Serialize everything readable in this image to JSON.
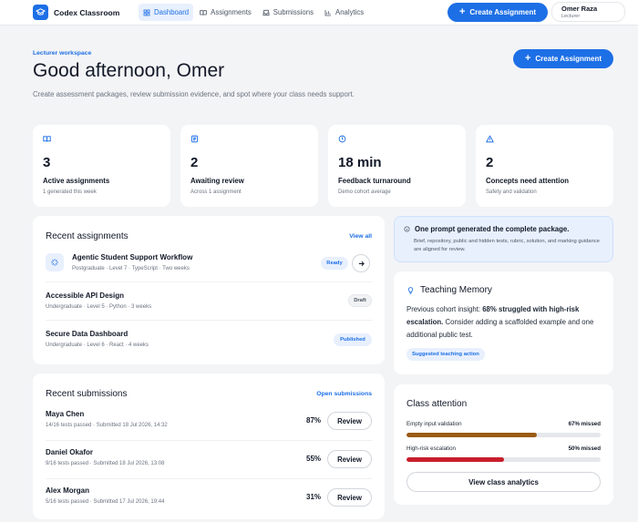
{
  "app": {
    "name": "Codex Classroom"
  },
  "nav": {
    "items": [
      {
        "label": "Dashboard",
        "icon": "grid-icon",
        "active": true
      },
      {
        "label": "Assignments",
        "icon": "book-icon",
        "active": false
      },
      {
        "label": "Submissions",
        "icon": "inbox-icon",
        "active": false
      },
      {
        "label": "Analytics",
        "icon": "bar-chart-icon",
        "active": false
      }
    ]
  },
  "top_create_label": "Create Assignment",
  "user": {
    "name": "Omer Raza",
    "role": "Lecturer"
  },
  "header": {
    "eyebrow": "Lecturer workspace",
    "greeting": "Good afternoon, Omer",
    "subtitle": "Create assessment packages, review submission evidence, and spot where your class needs support.",
    "create_label": "Create Assignment"
  },
  "stats": [
    {
      "icon": "book-open-icon",
      "value": "3",
      "label": "Active assignments",
      "sub": "1 generated this week"
    },
    {
      "icon": "document-icon",
      "value": "2",
      "label": "Awaiting review",
      "sub": "Across 1 assignment"
    },
    {
      "icon": "clock-icon",
      "value": "18 min",
      "label": "Feedback turnaround",
      "sub": "Demo cohort average"
    },
    {
      "icon": "warning-icon",
      "value": "2",
      "label": "Concepts need attention",
      "sub": "Safety and validation"
    }
  ],
  "recent_assignments": {
    "title": "Recent assignments",
    "view_all": "View all",
    "items": [
      {
        "title": "Agentic Student Support Workflow",
        "meta": "Postgraduate · Level 7 · TypeScript · Two weeks",
        "status": "Ready"
      },
      {
        "title": "Accessible API Design",
        "meta": "Undergraduate · Level 5 · Python · 3 weeks",
        "status": "Draft"
      },
      {
        "title": "Secure Data Dashboard",
        "meta": "Undergraduate · Level 6 · React · 4 weeks",
        "status": "Published"
      }
    ]
  },
  "recent_submissions": {
    "title": "Recent submissions",
    "open_link": "Open submissions",
    "review_label": "Review",
    "items": [
      {
        "name": "Maya Chen",
        "meta": "14/16 tests passed · Submitted 18 Jul 2026, 14:32",
        "score": "87%"
      },
      {
        "name": "Daniel Okafor",
        "meta": "9/16 tests passed · Submitted 18 Jul 2026, 13:08",
        "score": "55%"
      },
      {
        "name": "Alex Morgan",
        "meta": "5/16 tests passed · Submitted 17 Jul 2026, 19:44",
        "score": "31%"
      }
    ]
  },
  "insight": {
    "title": "One prompt generated the complete package.",
    "body": "Brief, repository, public and hidden tests, rubric, solution, and marking guidance are aligned for review."
  },
  "teaching_memory": {
    "title": "Teaching Memory",
    "text_prefix": "Previous cohort insight: ",
    "text_bold": "68% struggled with high-risk escalation.",
    "text_suffix": " Consider adding a scaffolded example and one additional public test.",
    "chip": "Suggested teaching action"
  },
  "class_attention": {
    "title": "Class attention",
    "bars": [
      {
        "label": "Empty input validation",
        "value_label": "67% missed",
        "fraction": 0.67,
        "color": "#9a5b13"
      },
      {
        "label": "High-risk escalation",
        "value_label": "50% missed",
        "fraction": 0.5,
        "color": "#c81e2b"
      }
    ],
    "button": "View class analytics"
  }
}
